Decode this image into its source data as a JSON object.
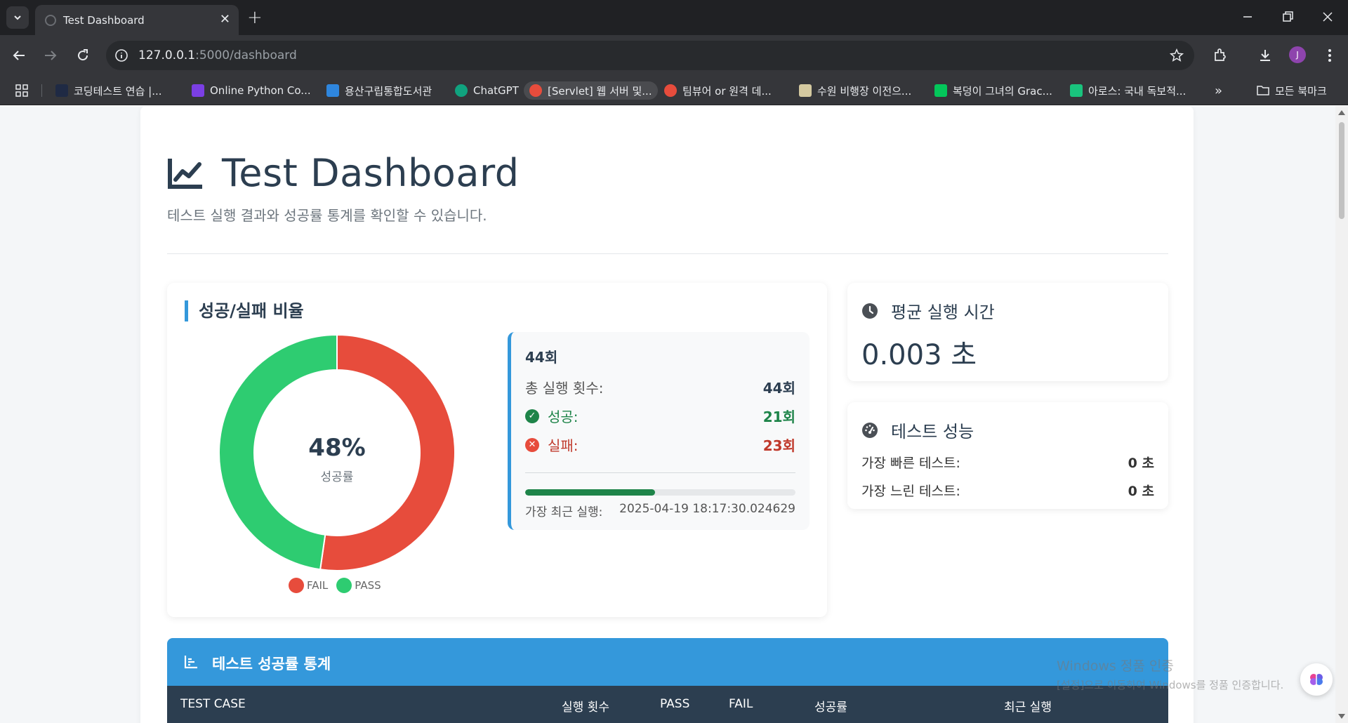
{
  "browser": {
    "tab_title": "Test Dashboard",
    "url_host": "127.0.0.1",
    "url_path": ":5000/dashboard",
    "profile_initial": "J",
    "bookmarks": [
      {
        "label": "코딩테스트 연습 |...",
        "color": "#1f2a44"
      },
      {
        "label": "Online Python Co...",
        "color": "#7b3fe4"
      },
      {
        "label": "용산구립통합도서관",
        "color": "#2e86de"
      },
      {
        "label": "ChatGPT",
        "color": "#10a37f"
      },
      {
        "label": "[Servlet] 웹 서버 및...",
        "color": "#e74c3c"
      },
      {
        "label": "팀뷰어 or 원격 데...",
        "color": "#e74c3c"
      },
      {
        "label": "수원 비행장 이전으...",
        "color": "#d4c9a0"
      },
      {
        "label": "복덩이 그녀의 Grac...",
        "color": "#03c75a"
      },
      {
        "label": "아로스: 국내 독보적...",
        "color": "#19c37d"
      }
    ],
    "bookmarks_more": "»",
    "all_bookmarks": "모든 북마크"
  },
  "page": {
    "title": "Test Dashboard",
    "subtitle": "테스트 실행 결과와 성공률 통계를 확인할 수 있습니다."
  },
  "ratio_card": {
    "heading": "성공/실패 비율",
    "center_percent": "48%",
    "center_label": "성공률",
    "legend": [
      {
        "label": "FAIL",
        "color": "#e74c3c"
      },
      {
        "label": "PASS",
        "color": "#2ecc71"
      }
    ]
  },
  "chart_data": {
    "type": "pie",
    "style": "donut",
    "labels": [
      "FAIL",
      "PASS"
    ],
    "values": [
      23,
      21
    ],
    "colors": [
      "#e74c3c",
      "#2ecc71"
    ],
    "legend_position": "bottom"
  },
  "summary": {
    "heading": "44회",
    "total_label": "총 실행 횟수:",
    "total_value": "44회",
    "success_label": "성공:",
    "success_value": "21회",
    "fail_label": "실패:",
    "fail_value": "23회",
    "progress_fraction": 0.48,
    "recent_label": "가장 최근 실행:",
    "recent_value": "2025-04-19 18:17:30.024629"
  },
  "avg_card": {
    "title": "평균 실행 시간",
    "value": "0.003 초"
  },
  "perf_card": {
    "title": "테스트 성능",
    "fastest_label": "가장 빠른 테스트:",
    "fastest_value": "0 초",
    "slowest_label": "가장 느린 테스트:",
    "slowest_value": "0 초"
  },
  "stats": {
    "title": "테스트 성공률 통계",
    "columns": [
      "TEST CASE",
      "실행 횟수",
      "PASS",
      "FAIL",
      "성공률",
      "최근 실행"
    ]
  },
  "watermark": {
    "line1": "Windows 정품 인증",
    "line2": "[설정]으로 이동하여 Windows를 정품 인증합니다."
  },
  "colors": {
    "accent": "#3498db",
    "dark": "#2c3e50",
    "success": "#1e8449",
    "danger": "#c0392b"
  }
}
